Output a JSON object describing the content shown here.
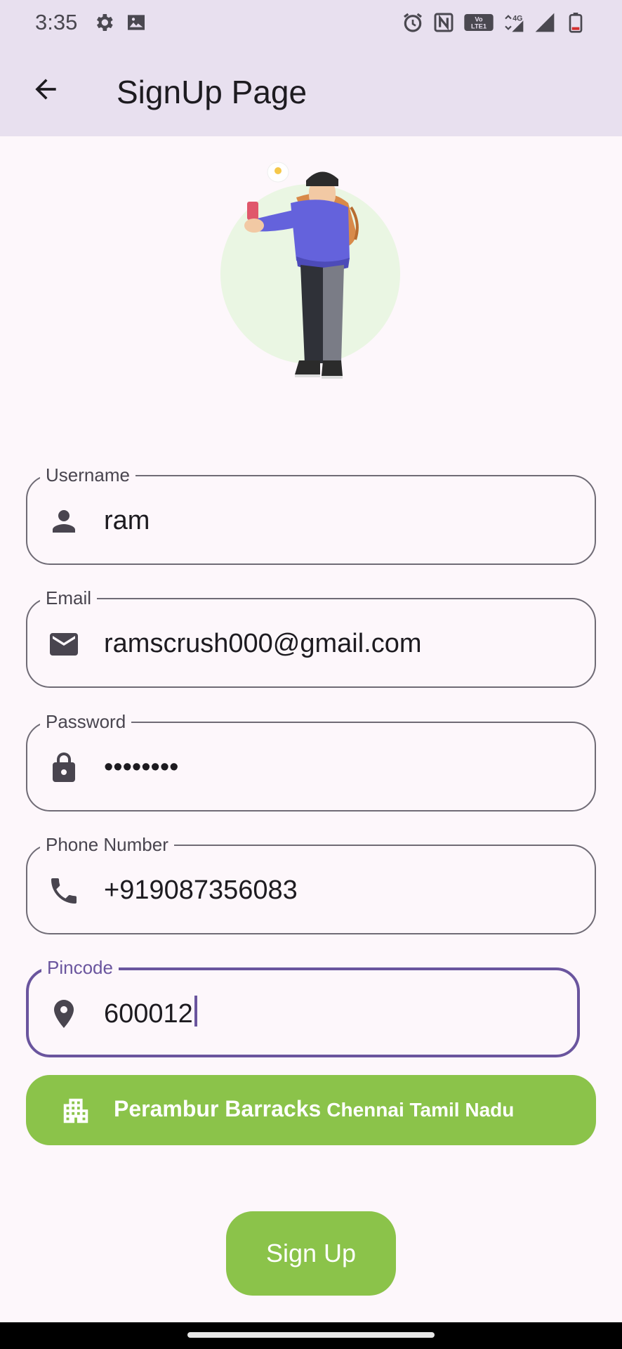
{
  "status_bar": {
    "time": "3:35",
    "left_icons": [
      "settings-icon",
      "image-icon"
    ],
    "right_icons": [
      "alarm-icon",
      "nfc-icon",
      "volte-icon",
      "4g-icon",
      "signal-icon",
      "battery-icon"
    ],
    "network_label": "4G",
    "volte_label": "VoLTE 1"
  },
  "app_bar": {
    "title": "SignUp Page",
    "back_icon": "arrow-back-icon"
  },
  "form": {
    "username": {
      "label": "Username",
      "value": "ram",
      "icon": "person-icon"
    },
    "email": {
      "label": "Email",
      "value": "ramscrush000@gmail.com",
      "icon": "mail-icon"
    },
    "password": {
      "label": "Password",
      "value": "••••••••",
      "icon": "lock-icon"
    },
    "phone": {
      "label": "Phone Number",
      "value": "+919087356083",
      "icon": "phone-icon"
    },
    "pincode": {
      "label": "Pincode",
      "value": "600012",
      "icon": "location-pin-icon",
      "focused": true
    }
  },
  "location": {
    "icon": "apartment-icon",
    "area": "Perambur Barracks",
    "city_state": "Chennai Tamil Nadu"
  },
  "signup_button": {
    "label": "Sign Up"
  },
  "colors": {
    "app_bar": "#e8e0ef",
    "background": "#fdf7fb",
    "accent_green": "#8bc34a",
    "focus_purple": "#6a559e"
  }
}
